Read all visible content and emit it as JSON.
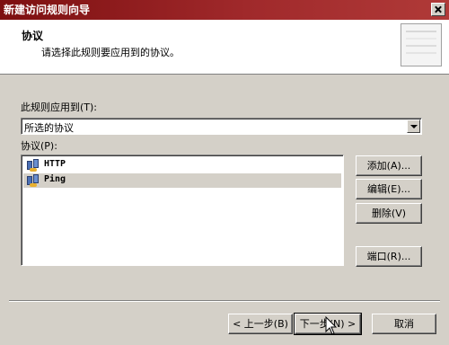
{
  "window": {
    "title": "新建访问规则向导"
  },
  "header": {
    "title": "协议",
    "subtitle": "请选择此规则要应用到的协议。"
  },
  "apply_to": {
    "label": "此规则应用到(T):",
    "selected": "所选的协议"
  },
  "protocols": {
    "label": "协议(P):",
    "items": [
      {
        "name": "HTTP"
      },
      {
        "name": "Ping"
      }
    ]
  },
  "buttons": {
    "add": "添加(A)...",
    "edit": "编辑(E)...",
    "remove": "删除(V)",
    "ports": "端口(R)..."
  },
  "nav": {
    "back": "< 上一步(B)",
    "next": "下一步(N) >",
    "cancel": "取消"
  }
}
